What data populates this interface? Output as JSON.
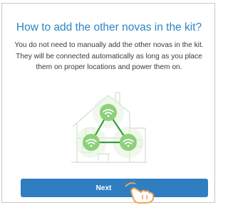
{
  "dialog": {
    "title": "How to add the other novas in the kit?",
    "description": "You do not need to manually add the other novas in the kit. They will be connected automatically as long as you place them on proper locations and power them on.",
    "next_label": "Next"
  },
  "illustration": {
    "icon": "house-with-three-wifi-nodes",
    "node_color": "#8dd07a",
    "link_color": "#3a9c3f"
  },
  "pointer": {
    "icon": "hand-pointer-icon"
  },
  "colors": {
    "title": "#2b86c6",
    "button": "#2f7ec2",
    "text": "#3a3a3a"
  }
}
